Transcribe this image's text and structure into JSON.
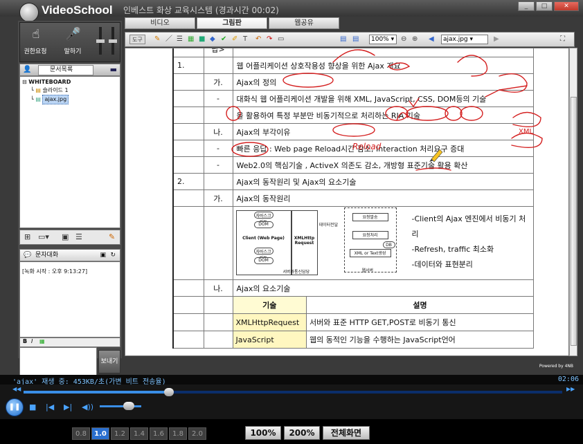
{
  "app": {
    "logo_text": "VideoSchool",
    "window_title": "인베스트 화상 교육시스템 (경과시간 00:02)",
    "tabs": [
      "비디오",
      "그림판",
      "웹공유"
    ],
    "active_tab": "그림판"
  },
  "left_panel": {
    "controls": [
      {
        "label": "권한요청",
        "icon": "raise-hand-icon"
      },
      {
        "label": "말하기",
        "icon": "microphone-icon"
      }
    ],
    "doc_tab": "문서목록",
    "tree": {
      "root": "WHITEBOARD",
      "items": [
        "슬라이드 1",
        "ajax.jpg"
      ],
      "selected": "ajax.jpg"
    },
    "chat": {
      "header": "문자대화",
      "messages": [
        "[녹화 시작 : 오후 9:13:27]"
      ],
      "send_label": "보내기"
    }
  },
  "toolbar": {
    "tool_label": "도구",
    "zoom": "100%",
    "file": "ajax.jpg"
  },
  "document": {
    "rows": [
      {
        "c1": "",
        "c2": "답>",
        "text": ""
      },
      {
        "c1": "1.",
        "c2": "",
        "text": "웹 어플리케이션 상호작용성 향상을 위한 Ajax 개요"
      },
      {
        "c1": "",
        "c2": "가.",
        "text": "Ajax의 정의"
      },
      {
        "c1": "",
        "c2": "-",
        "text": "대화식 웹 어플리케이션 개발을 위해 XML, JavaScript, CSS, DOM등의 기술"
      },
      {
        "c1": "",
        "c2": "",
        "text": "을 활용하여 특정 부분만 비동기적으로 처리하는 RIA 기술"
      },
      {
        "c1": "",
        "c2": "나.",
        "text": "Ajax의 부각이유"
      },
      {
        "c1": "",
        "c2": "-",
        "text": "빠른 응답 : Web page Reload시간 감소, Interaction 처리요구 증대"
      },
      {
        "c1": "",
        "c2": "-",
        "text": "Web2.0의 핵심기술 , ActiveX 의존도 감소, 개방형 표준기술 활용 확산"
      },
      {
        "c1": "2.",
        "c2": "",
        "text": "Ajax의 동작원리 및 Ajax의 요소기술"
      },
      {
        "c1": "",
        "c2": "가.",
        "text": "Ajax의 동작원리"
      }
    ],
    "diagram": {
      "client": "Client (Web Page)",
      "xmlhttp": "XMLHttp Request",
      "request": "요청발송",
      "process": "요청처리",
      "result": "XML or Text생성",
      "db": "DB",
      "data_transfer": "데이터전달",
      "async": "서버와통신담당",
      "server": "웹서버",
      "js_call": "자바스크립트",
      "dom": "DOM",
      "bullets": [
        "-Client의 Ajax 엔진에서 비동기 처리",
        "-Refresh, traffic 최소화",
        "-데이터와 표현분리"
      ]
    },
    "subsection": {
      "c2": "나.",
      "text": "Ajax의 요소기술"
    },
    "table_header": {
      "tech": "기술",
      "desc": "설명"
    },
    "table_rows": [
      {
        "tech": "XMLHttpRequest",
        "desc": "서버와 표준 HTTP GET,POST로 비동기 통신"
      },
      {
        "tech": "JavaScript",
        "desc": "웹의 동적인 기능을 수행하는 JavaScript언어"
      }
    ],
    "annotations": {
      "reload": "Reload",
      "xml": "XML"
    }
  },
  "powered_by": "Powered by 4NB",
  "status": {
    "left": "'ajax' 재생 중: 453KB/초(가변 비트 전송율)",
    "time": "02:06"
  },
  "player": {
    "progress": 0.27,
    "volume": 0.7
  },
  "bottom": {
    "speeds": [
      "0.8",
      "1.0",
      "1.2",
      "1.4",
      "1.6",
      "1.8",
      "2.0"
    ],
    "active_speed": "1.0",
    "zoom_buttons": [
      "100%",
      "200%",
      "전체화면"
    ]
  }
}
